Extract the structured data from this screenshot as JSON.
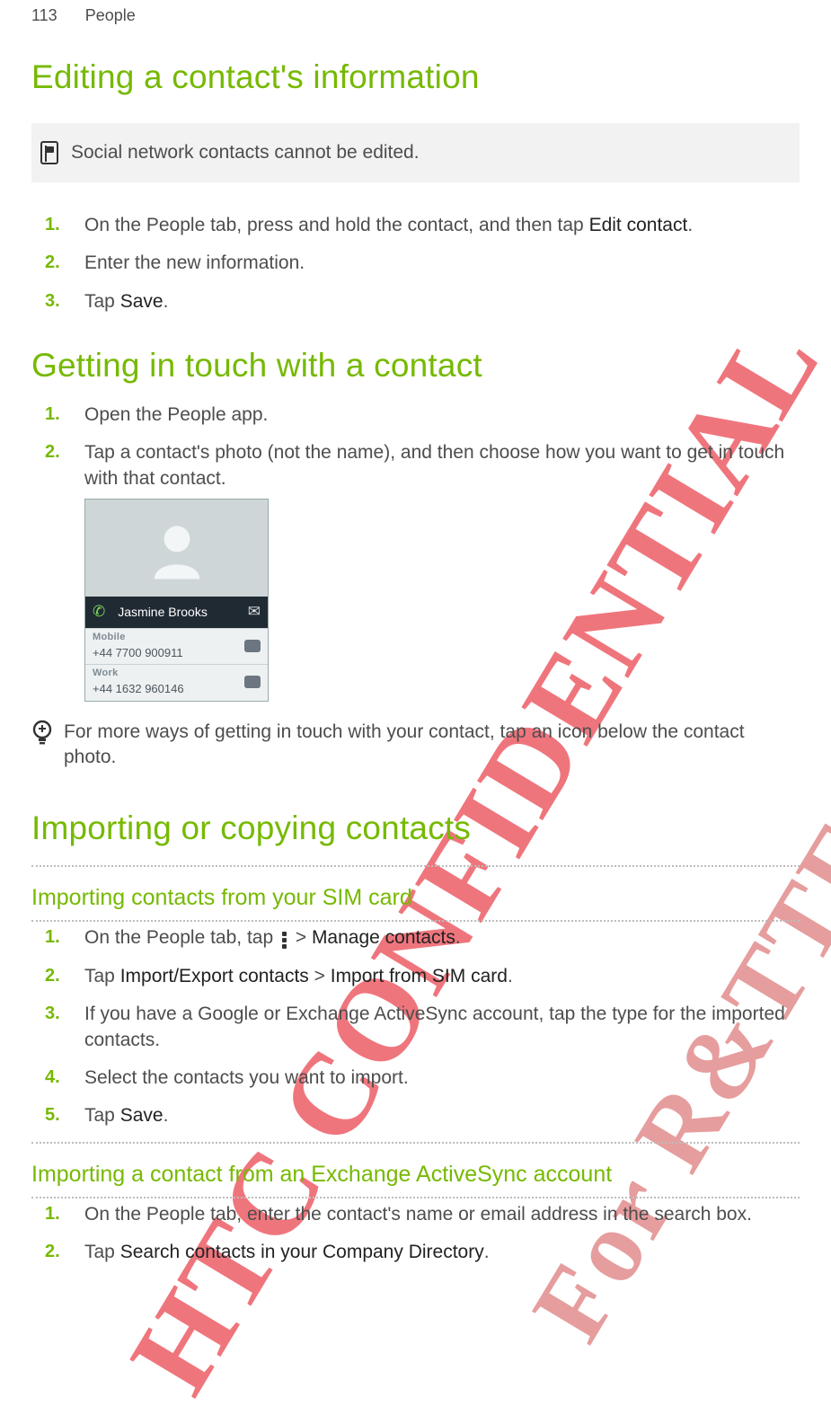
{
  "header": {
    "page_number": "113",
    "section": "People"
  },
  "s1": {
    "title": "Editing a contact's information",
    "note": "Social network contacts cannot be edited.",
    "steps": {
      "a_pre": "On the People tab, press and hold the contact, and then tap ",
      "a_bold": "Edit contact",
      "a_post": ".",
      "b": "Enter the new information.",
      "c_pre": "Tap ",
      "c_bold": "Save",
      "c_post": "."
    }
  },
  "s2": {
    "title": "Getting in touch with a contact",
    "step1": "Open the People app.",
    "step2": "Tap a contact's photo (not the name), and then choose how you want to get in touch with that contact.",
    "shot": {
      "name": "Jasmine Brooks",
      "mobile_label": "Mobile",
      "mobile_number": "+44 7700 900911",
      "work_label": "Work",
      "work_number": "+44 1632 960146"
    },
    "tip": "For more ways of getting in touch with your contact, tap an icon below the contact photo."
  },
  "s3": {
    "title": "Importing or copying contacts",
    "sub1": "Importing contacts from your SIM card",
    "sub1_steps": {
      "a_pre": "On the People tab, tap ",
      "a_mid": " > ",
      "a_bold": "Manage contacts",
      "a_post": ".",
      "b_pre": "Tap ",
      "b_bold1": "Import/Export contacts",
      "b_mid": " > ",
      "b_bold2": "Import from SIM card",
      "b_post": ".",
      "c": "If you have a Google or Exchange ActiveSync account, tap the type for the imported contacts.",
      "d": "Select the contacts you want to import.",
      "e_pre": "Tap ",
      "e_bold": "Save",
      "e_post": "."
    },
    "sub2": "Importing a contact from an Exchange ActiveSync account",
    "sub2_steps": {
      "a": "On the People tab, enter the contact's name or email address in the search box.",
      "b_pre": "Tap ",
      "b_bold": "Search contacts in your Company Directory",
      "b_post": "."
    }
  },
  "watermarks": {
    "w1": "HTC CONFIDENTIAL",
    "w2": "For R&TTE Certification only"
  }
}
